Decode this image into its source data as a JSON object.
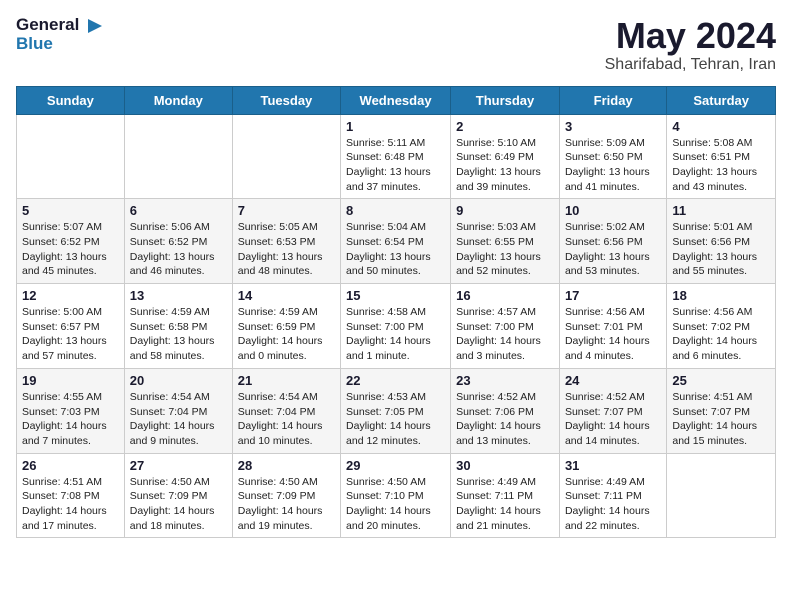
{
  "header": {
    "logo_line1": "General",
    "logo_line2": "Blue",
    "title": "May 2024",
    "subtitle": "Sharifabad, Tehran, Iran"
  },
  "weekdays": [
    "Sunday",
    "Monday",
    "Tuesday",
    "Wednesday",
    "Thursday",
    "Friday",
    "Saturday"
  ],
  "weeks": [
    [
      {
        "day": "",
        "info": ""
      },
      {
        "day": "",
        "info": ""
      },
      {
        "day": "",
        "info": ""
      },
      {
        "day": "1",
        "info": "Sunrise: 5:11 AM\nSunset: 6:48 PM\nDaylight: 13 hours and 37 minutes."
      },
      {
        "day": "2",
        "info": "Sunrise: 5:10 AM\nSunset: 6:49 PM\nDaylight: 13 hours and 39 minutes."
      },
      {
        "day": "3",
        "info": "Sunrise: 5:09 AM\nSunset: 6:50 PM\nDaylight: 13 hours and 41 minutes."
      },
      {
        "day": "4",
        "info": "Sunrise: 5:08 AM\nSunset: 6:51 PM\nDaylight: 13 hours and 43 minutes."
      }
    ],
    [
      {
        "day": "5",
        "info": "Sunrise: 5:07 AM\nSunset: 6:52 PM\nDaylight: 13 hours and 45 minutes."
      },
      {
        "day": "6",
        "info": "Sunrise: 5:06 AM\nSunset: 6:52 PM\nDaylight: 13 hours and 46 minutes."
      },
      {
        "day": "7",
        "info": "Sunrise: 5:05 AM\nSunset: 6:53 PM\nDaylight: 13 hours and 48 minutes."
      },
      {
        "day": "8",
        "info": "Sunrise: 5:04 AM\nSunset: 6:54 PM\nDaylight: 13 hours and 50 minutes."
      },
      {
        "day": "9",
        "info": "Sunrise: 5:03 AM\nSunset: 6:55 PM\nDaylight: 13 hours and 52 minutes."
      },
      {
        "day": "10",
        "info": "Sunrise: 5:02 AM\nSunset: 6:56 PM\nDaylight: 13 hours and 53 minutes."
      },
      {
        "day": "11",
        "info": "Sunrise: 5:01 AM\nSunset: 6:56 PM\nDaylight: 13 hours and 55 minutes."
      }
    ],
    [
      {
        "day": "12",
        "info": "Sunrise: 5:00 AM\nSunset: 6:57 PM\nDaylight: 13 hours and 57 minutes."
      },
      {
        "day": "13",
        "info": "Sunrise: 4:59 AM\nSunset: 6:58 PM\nDaylight: 13 hours and 58 minutes."
      },
      {
        "day": "14",
        "info": "Sunrise: 4:59 AM\nSunset: 6:59 PM\nDaylight: 14 hours and 0 minutes."
      },
      {
        "day": "15",
        "info": "Sunrise: 4:58 AM\nSunset: 7:00 PM\nDaylight: 14 hours and 1 minute."
      },
      {
        "day": "16",
        "info": "Sunrise: 4:57 AM\nSunset: 7:00 PM\nDaylight: 14 hours and 3 minutes."
      },
      {
        "day": "17",
        "info": "Sunrise: 4:56 AM\nSunset: 7:01 PM\nDaylight: 14 hours and 4 minutes."
      },
      {
        "day": "18",
        "info": "Sunrise: 4:56 AM\nSunset: 7:02 PM\nDaylight: 14 hours and 6 minutes."
      }
    ],
    [
      {
        "day": "19",
        "info": "Sunrise: 4:55 AM\nSunset: 7:03 PM\nDaylight: 14 hours and 7 minutes."
      },
      {
        "day": "20",
        "info": "Sunrise: 4:54 AM\nSunset: 7:04 PM\nDaylight: 14 hours and 9 minutes."
      },
      {
        "day": "21",
        "info": "Sunrise: 4:54 AM\nSunset: 7:04 PM\nDaylight: 14 hours and 10 minutes."
      },
      {
        "day": "22",
        "info": "Sunrise: 4:53 AM\nSunset: 7:05 PM\nDaylight: 14 hours and 12 minutes."
      },
      {
        "day": "23",
        "info": "Sunrise: 4:52 AM\nSunset: 7:06 PM\nDaylight: 14 hours and 13 minutes."
      },
      {
        "day": "24",
        "info": "Sunrise: 4:52 AM\nSunset: 7:07 PM\nDaylight: 14 hours and 14 minutes."
      },
      {
        "day": "25",
        "info": "Sunrise: 4:51 AM\nSunset: 7:07 PM\nDaylight: 14 hours and 15 minutes."
      }
    ],
    [
      {
        "day": "26",
        "info": "Sunrise: 4:51 AM\nSunset: 7:08 PM\nDaylight: 14 hours and 17 minutes."
      },
      {
        "day": "27",
        "info": "Sunrise: 4:50 AM\nSunset: 7:09 PM\nDaylight: 14 hours and 18 minutes."
      },
      {
        "day": "28",
        "info": "Sunrise: 4:50 AM\nSunset: 7:09 PM\nDaylight: 14 hours and 19 minutes."
      },
      {
        "day": "29",
        "info": "Sunrise: 4:50 AM\nSunset: 7:10 PM\nDaylight: 14 hours and 20 minutes."
      },
      {
        "day": "30",
        "info": "Sunrise: 4:49 AM\nSunset: 7:11 PM\nDaylight: 14 hours and 21 minutes."
      },
      {
        "day": "31",
        "info": "Sunrise: 4:49 AM\nSunset: 7:11 PM\nDaylight: 14 hours and 22 minutes."
      },
      {
        "day": "",
        "info": ""
      }
    ]
  ]
}
